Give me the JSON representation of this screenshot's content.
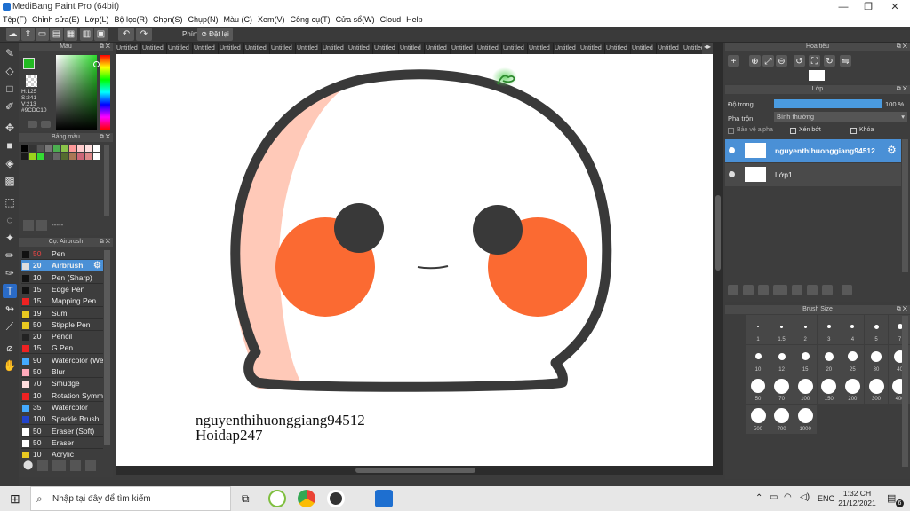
{
  "window": {
    "title": "MediBang Paint Pro (64bit)",
    "minimize": "—",
    "maximize": "❐",
    "close": "✕"
  },
  "menu": [
    "Tệp(F)",
    "Chỉnh sửa(E)",
    "Lớp(L)",
    "Bộ lọc(R)",
    "Chọn(S)",
    "Chụp(N)",
    "Màu (C)",
    "Xem(V)",
    "Công cụ(T)",
    "Cửa sổ(W)",
    "Cloud",
    "Help"
  ],
  "toolbar": {
    "key_label": "Phím",
    "reset_label": "Đặt lại"
  },
  "tabs": [
    "Untitled",
    "Untitled",
    "Untitled",
    "Untitled",
    "Untitled",
    "Untitled",
    "Untitled",
    "Untitled",
    "Untitled",
    "Untitled",
    "Untitled",
    "Untitled",
    "Untitled",
    "Untitled",
    "Untitled",
    "Untitled",
    "Untitled",
    "Untitled",
    "Untitled",
    "Untitled",
    "Untitled",
    "Untitled",
    "Untitled"
  ],
  "color_panel": {
    "title": "Màu",
    "h": "H:125",
    "s": "S:241",
    "v": "V:213",
    "hex": "#9CDC10",
    "current_color": "#22bb22"
  },
  "palette_panel": {
    "title": "Bảng màu",
    "dash": "-----",
    "swatches": [
      "#000000",
      "#333333",
      "#555555",
      "#777777",
      "#4caf50",
      "#8bc34a",
      "#ff9999",
      "#ffcccc",
      "#ffe0e0",
      "#ffffff",
      "#1a1a1a",
      "#9bd21c",
      "#33dd33",
      "#444444",
      "#666666",
      "#556b2f",
      "#aa7755",
      "#cc6677",
      "#dd8888",
      "#ffffff"
    ]
  },
  "brush_panel": {
    "title": "Cọ: Airbrush",
    "brushes": [
      {
        "n": "50",
        "label": "Pen",
        "color": "#111111"
      },
      {
        "n": "20",
        "label": "Airbrush",
        "color": "#dddddd"
      },
      {
        "n": "10",
        "label": "Pen (Sharp)",
        "color": "#111111"
      },
      {
        "n": "15",
        "label": "Edge Pen",
        "color": "#111111"
      },
      {
        "n": "15",
        "label": "Mapping Pen",
        "color": "#ee2222"
      },
      {
        "n": "19",
        "label": "Sumi",
        "color": "#e8c820"
      },
      {
        "n": "50",
        "label": "Stipple Pen",
        "color": "#e8c820"
      },
      {
        "n": "20",
        "label": "Pencil",
        "color": "#222222"
      },
      {
        "n": "15",
        "label": "G Pen",
        "color": "#ee2222"
      },
      {
        "n": "90",
        "label": "Watercolor (We",
        "color": "#44aaff"
      },
      {
        "n": "50",
        "label": "Blur",
        "color": "#ffaabb"
      },
      {
        "n": "70",
        "label": "Smudge",
        "color": "#ffdddd"
      },
      {
        "n": "10",
        "label": "Rotation Symm",
        "color": "#ee2222"
      },
      {
        "n": "35",
        "label": "Watercolor",
        "color": "#44aaff"
      },
      {
        "n": "100",
        "label": "Sparkle Brush",
        "color": "#2244cc"
      },
      {
        "n": "50",
        "label": "Eraser (Soft)",
        "color": "#ffffff"
      },
      {
        "n": "50",
        "label": "Eraser",
        "color": "#ffffff"
      },
      {
        "n": "10",
        "label": "Acrylic",
        "color": "#e8c820"
      }
    ]
  },
  "navigator": {
    "title": "Hoa tiêu"
  },
  "layer_panel": {
    "title": "Lớp",
    "opacity_label": "Độ trong",
    "opacity_value": "100 %",
    "opacity_level": 1.0,
    "blend_label": "Pha trộn",
    "blend_value": "Bình thường",
    "protect_alpha": "Bảo vệ alpha",
    "clipping": "Xén bớt",
    "lock": "Khóa",
    "layers": [
      "nguyenthihuonggiang94512",
      "Lớp1"
    ]
  },
  "brush_size_panel": {
    "title": "Brush Size",
    "sizes": [
      "1",
      "1.5",
      "2",
      "3",
      "4",
      "5",
      "7",
      "10",
      "12",
      "15",
      "20",
      "25",
      "30",
      "40",
      "50",
      "70",
      "100",
      "150",
      "200",
      "300",
      "400",
      "500",
      "700",
      "1000"
    ]
  },
  "canvas_text": {
    "line1": "nguyenthihuonggiang94512",
    "line2": "Hoidap247"
  },
  "taskbar": {
    "search_placeholder": "Nhập tại đây để tìm kiếm",
    "time": "1:32 CH",
    "date": "21/12/2021",
    "lang": "ENG",
    "notif": "6"
  }
}
